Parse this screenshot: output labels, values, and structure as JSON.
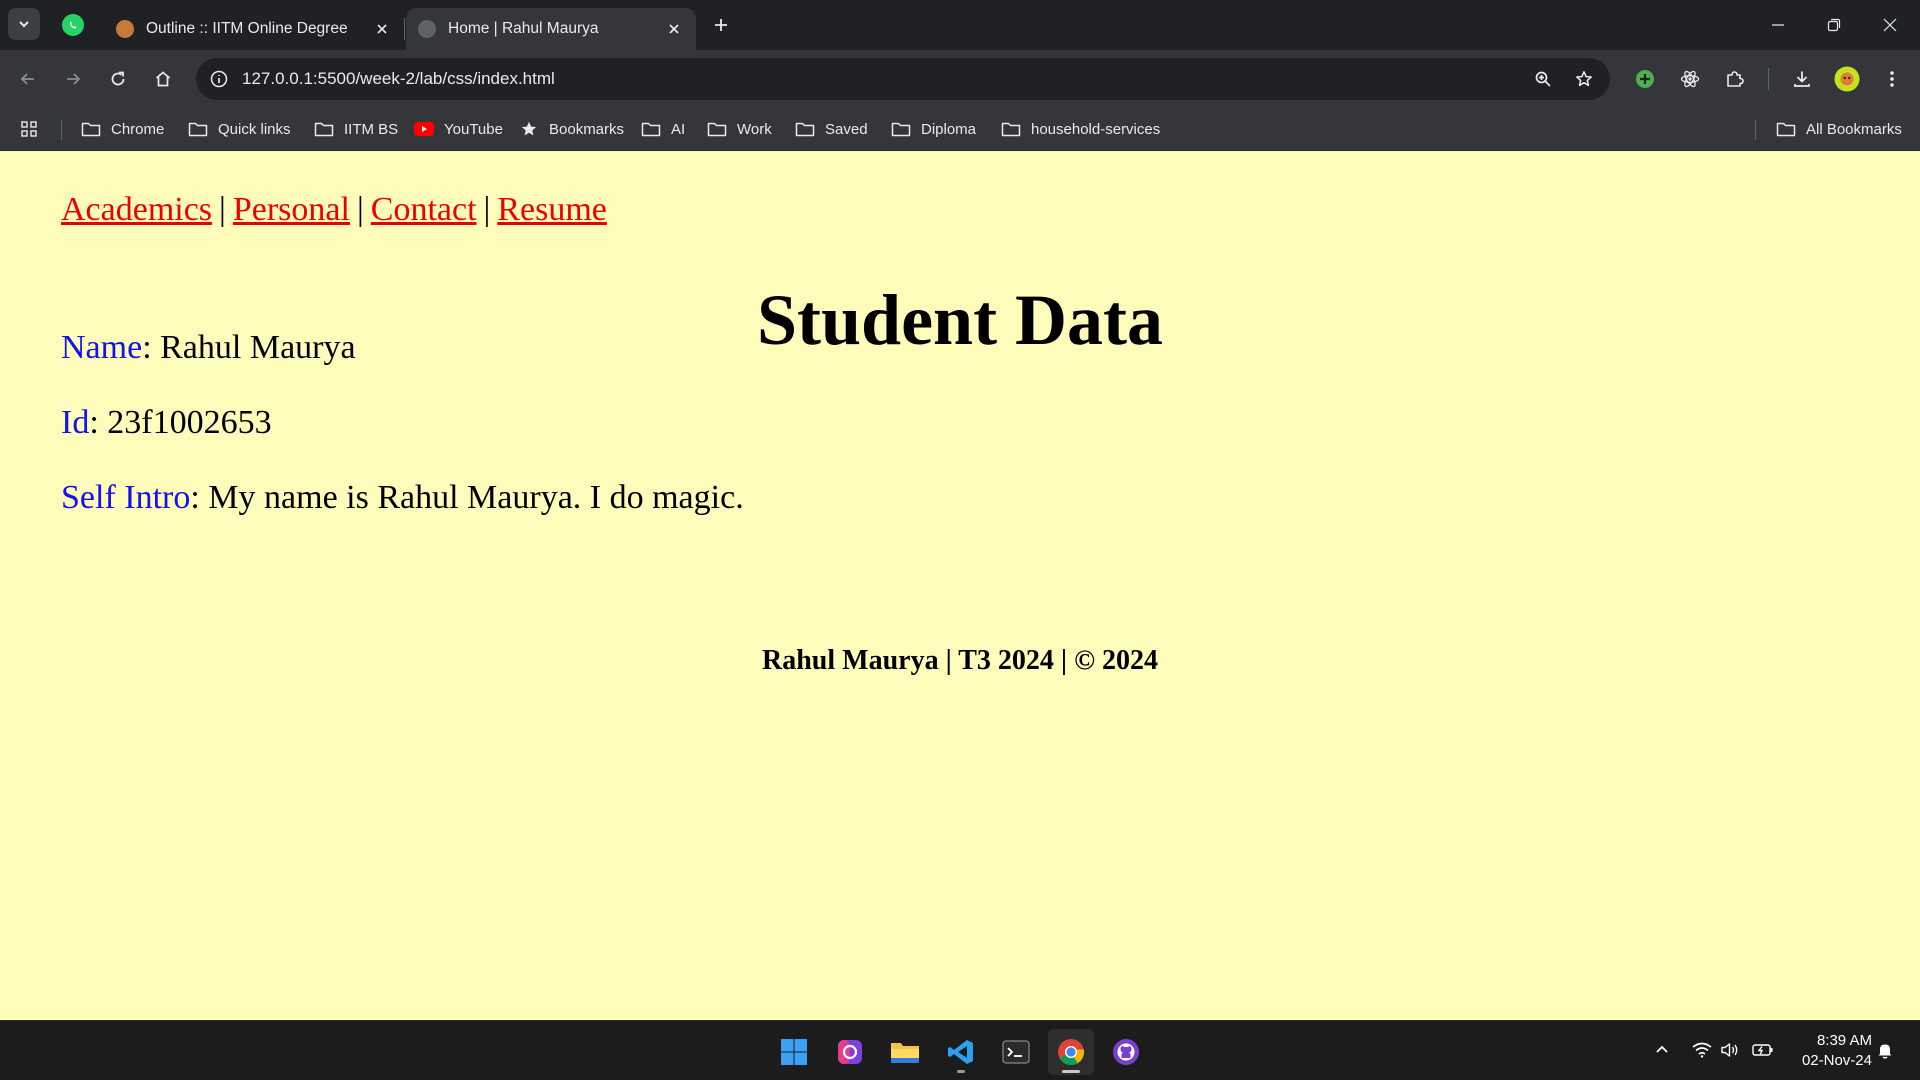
{
  "browser": {
    "tabs": [
      {
        "title": "Outline :: IITM Online Degree",
        "active": false
      },
      {
        "title": "Home | Rahul Maurya",
        "active": true
      }
    ],
    "address": "127.0.0.1:5500/week-2/lab/css/index.html",
    "bookmarks": [
      {
        "label": "Chrome",
        "icon": "folder-icon"
      },
      {
        "label": "Quick links",
        "icon": "folder-icon"
      },
      {
        "label": "IITM BS",
        "icon": "folder-icon"
      },
      {
        "label": "YouTube",
        "icon": "youtube-icon"
      },
      {
        "label": "Bookmarks",
        "icon": "star-icon"
      },
      {
        "label": "AI",
        "icon": "folder-icon"
      },
      {
        "label": "Work",
        "icon": "folder-icon"
      },
      {
        "label": "Saved",
        "icon": "folder-icon"
      },
      {
        "label": "Diploma",
        "icon": "folder-icon"
      },
      {
        "label": "household-services",
        "icon": "folder-icon"
      }
    ],
    "all_bookmarks": "All Bookmarks"
  },
  "page": {
    "nav": [
      {
        "label": "Academics"
      },
      {
        "label": "Personal"
      },
      {
        "label": "Contact"
      },
      {
        "label": "Resume"
      }
    ],
    "nav_separator": "|",
    "heading": "Student Data",
    "fields": [
      {
        "label": "Name",
        "value": ": Rahul Maurya"
      },
      {
        "label": "Id",
        "value": ": 23f1002653"
      },
      {
        "label": "Self Intro",
        "value": ": My name is Rahul Maurya. I do magic."
      }
    ],
    "footer": "Rahul Maurya | T3 2024 | © 2024"
  },
  "taskbar": {
    "time": "8:39 AM",
    "date": "02-Nov-24"
  },
  "colors": {
    "page_background": "#fdfcbb",
    "nav_link": "#ee0000",
    "field_label": "#1212ee",
    "browser_chrome": "#35363a"
  }
}
